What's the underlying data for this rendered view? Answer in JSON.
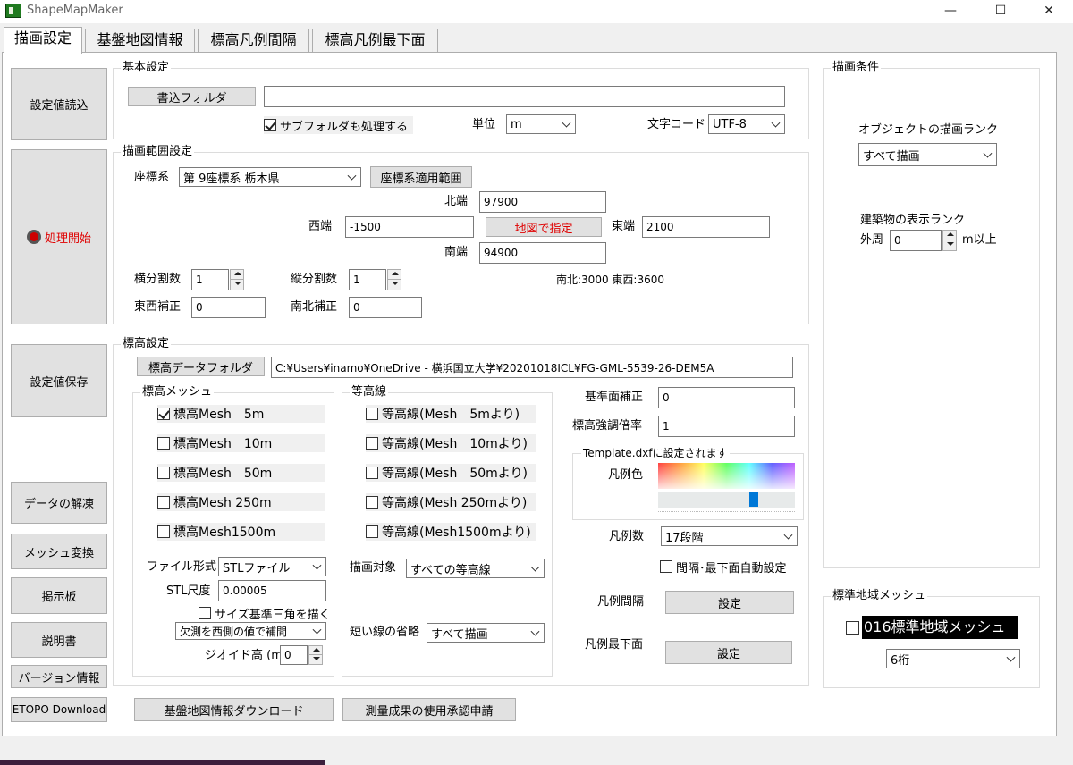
{
  "window": {
    "title": "ShapeMapMaker",
    "minimize": "—",
    "maximize": "☐",
    "close": "✕"
  },
  "tabs": [
    "描画設定",
    "基盤地図情報",
    "標高凡例間隔",
    "標高凡例最下面"
  ],
  "left_buttons": {
    "load": "設定値読込",
    "start": "処理開始",
    "save": "設定値保存",
    "unpack": "データの解凍",
    "mesh_convert": "メッシュ変換",
    "board": "掲示板",
    "manual": "説明書",
    "version": "バージョン情報",
    "etopo": "ETOPO Download"
  },
  "basic": {
    "title": "基本設定",
    "folder_button": "書込フォルダ",
    "folder_path": "",
    "subfolder_label": "サブフォルダも処理する",
    "subfolder_checked": true,
    "unit_label": "単位",
    "unit_value": "m",
    "encoding_label": "文字コード",
    "encoding_value": "UTF-8"
  },
  "range": {
    "title": "描画範囲設定",
    "crs_label": "座標系",
    "crs_value": "第 9座標系 栃木県",
    "crs_button": "座標系適用範囲",
    "north_label": "北端",
    "north_value": "97900",
    "west_label": "西端",
    "west_value": "-1500",
    "map_button": "地図で指定",
    "east_label": "東端",
    "east_value": "2100",
    "south_label": "南端",
    "south_value": "94900",
    "hsplit_label": "横分割数",
    "hsplit_value": "1",
    "vsplit_label": "縦分割数",
    "vsplit_value": "1",
    "size_info": "南北:3000 東西:3600",
    "ew_corr_label": "東西補正",
    "ew_corr_value": "0",
    "ns_corr_label": "南北補正",
    "ns_corr_value": "0"
  },
  "elev": {
    "title": "標高設定",
    "folder_button": "標高データフォルダ",
    "folder_path": "C:¥Users¥inamo¥OneDrive - 横浜国立大学¥20201018ICL¥FG-GML-5539-26-DEM5A",
    "mesh_title": "標高メッシュ",
    "mesh_items": [
      {
        "label": "標高Mesh　5m",
        "checked": true
      },
      {
        "label": "標高Mesh　10m",
        "checked": false
      },
      {
        "label": "標高Mesh　50m",
        "checked": false
      },
      {
        "label": "標高Mesh 250m",
        "checked": false
      },
      {
        "label": "標高Mesh1500m",
        "checked": false
      }
    ],
    "contour_title": "等高線",
    "contour_items": [
      {
        "label": "等高線(Mesh　5mより)",
        "checked": false
      },
      {
        "label": "等高線(Mesh　10mより)",
        "checked": false
      },
      {
        "label": "等高線(Mesh　50mより)",
        "checked": false
      },
      {
        "label": "等高線(Mesh 250mより)",
        "checked": false
      },
      {
        "label": "等高線(Mesh1500mより)",
        "checked": false
      }
    ],
    "file_format_label": "ファイル形式",
    "file_format_value": "STLファイル",
    "stl_scale_label": "STL尺度",
    "stl_scale_value": "0.00005",
    "triangle_label": "サイズ基準三角を描く",
    "triangle_checked": false,
    "missing_value": "欠測を西側の値で補間",
    "geoid_label": "ジオイド高 (m)",
    "geoid_value": "0",
    "draw_target_label": "描画対象",
    "draw_target_value": "すべての等高線",
    "short_line_label": "短い線の省略",
    "short_line_value": "すべて描画",
    "base_corr_label": "基準面補正",
    "base_corr_value": "0",
    "exaggeration_label": "標高強調倍率",
    "exaggeration_value": "1",
    "template_title": "Template.dxfに設定されます",
    "legend_color_label": "凡例色",
    "legend_slider_level": 0.71,
    "legend_count_label": "凡例数",
    "legend_count_value": "17段階",
    "auto_label": "間隔･最下面自動設定",
    "auto_checked": false,
    "interval_label": "凡例間隔",
    "interval_button": "設定",
    "bottom_label": "凡例最下面",
    "bottom_button": "設定"
  },
  "bottom_buttons": {
    "kiban_download": "基盤地図情報ダウンロード",
    "survey_request": "測量成果の使用承認申請"
  },
  "draw_cond": {
    "title": "描画条件",
    "rank_label": "オブジェクトの描画ランク",
    "rank_value": "すべて描画",
    "building_label": "建築物の表示ランク",
    "outer_label": "外周",
    "outer_value": "0",
    "outer_unit": "m以上"
  },
  "std_mesh": {
    "title": "標準地域メッシュ",
    "label": "016標準地域メッシュ",
    "checked": false,
    "digits_value": "6桁"
  },
  "colors": {
    "accent": "#0078d7",
    "red": "#e00000"
  }
}
